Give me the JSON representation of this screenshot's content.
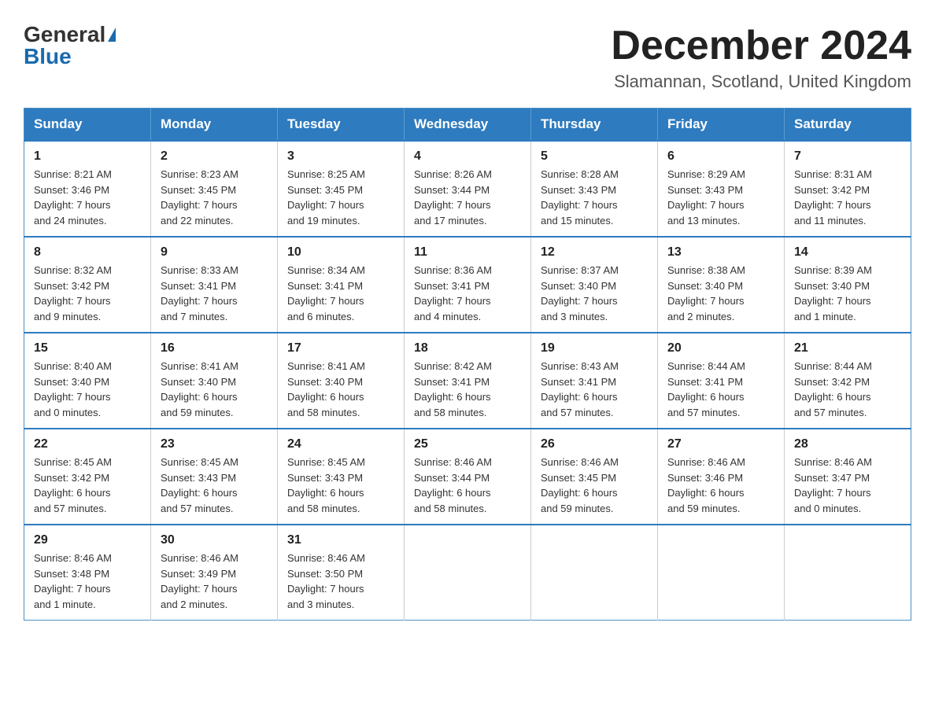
{
  "logo": {
    "general": "General",
    "blue": "Blue"
  },
  "title": "December 2024",
  "location": "Slamannan, Scotland, United Kingdom",
  "weekdays": [
    "Sunday",
    "Monday",
    "Tuesday",
    "Wednesday",
    "Thursday",
    "Friday",
    "Saturday"
  ],
  "weeks": [
    [
      {
        "day": "1",
        "sunrise": "8:21 AM",
        "sunset": "3:46 PM",
        "daylight": "7 hours and 24 minutes."
      },
      {
        "day": "2",
        "sunrise": "8:23 AM",
        "sunset": "3:45 PM",
        "daylight": "7 hours and 22 minutes."
      },
      {
        "day": "3",
        "sunrise": "8:25 AM",
        "sunset": "3:45 PM",
        "daylight": "7 hours and 19 minutes."
      },
      {
        "day": "4",
        "sunrise": "8:26 AM",
        "sunset": "3:44 PM",
        "daylight": "7 hours and 17 minutes."
      },
      {
        "day": "5",
        "sunrise": "8:28 AM",
        "sunset": "3:43 PM",
        "daylight": "7 hours and 15 minutes."
      },
      {
        "day": "6",
        "sunrise": "8:29 AM",
        "sunset": "3:43 PM",
        "daylight": "7 hours and 13 minutes."
      },
      {
        "day": "7",
        "sunrise": "8:31 AM",
        "sunset": "3:42 PM",
        "daylight": "7 hours and 11 minutes."
      }
    ],
    [
      {
        "day": "8",
        "sunrise": "8:32 AM",
        "sunset": "3:42 PM",
        "daylight": "7 hours and 9 minutes."
      },
      {
        "day": "9",
        "sunrise": "8:33 AM",
        "sunset": "3:41 PM",
        "daylight": "7 hours and 7 minutes."
      },
      {
        "day": "10",
        "sunrise": "8:34 AM",
        "sunset": "3:41 PM",
        "daylight": "7 hours and 6 minutes."
      },
      {
        "day": "11",
        "sunrise": "8:36 AM",
        "sunset": "3:41 PM",
        "daylight": "7 hours and 4 minutes."
      },
      {
        "day": "12",
        "sunrise": "8:37 AM",
        "sunset": "3:40 PM",
        "daylight": "7 hours and 3 minutes."
      },
      {
        "day": "13",
        "sunrise": "8:38 AM",
        "sunset": "3:40 PM",
        "daylight": "7 hours and 2 minutes."
      },
      {
        "day": "14",
        "sunrise": "8:39 AM",
        "sunset": "3:40 PM",
        "daylight": "7 hours and 1 minute."
      }
    ],
    [
      {
        "day": "15",
        "sunrise": "8:40 AM",
        "sunset": "3:40 PM",
        "daylight": "7 hours and 0 minutes."
      },
      {
        "day": "16",
        "sunrise": "8:41 AM",
        "sunset": "3:40 PM",
        "daylight": "6 hours and 59 minutes."
      },
      {
        "day": "17",
        "sunrise": "8:41 AM",
        "sunset": "3:40 PM",
        "daylight": "6 hours and 58 minutes."
      },
      {
        "day": "18",
        "sunrise": "8:42 AM",
        "sunset": "3:41 PM",
        "daylight": "6 hours and 58 minutes."
      },
      {
        "day": "19",
        "sunrise": "8:43 AM",
        "sunset": "3:41 PM",
        "daylight": "6 hours and 57 minutes."
      },
      {
        "day": "20",
        "sunrise": "8:44 AM",
        "sunset": "3:41 PM",
        "daylight": "6 hours and 57 minutes."
      },
      {
        "day": "21",
        "sunrise": "8:44 AM",
        "sunset": "3:42 PM",
        "daylight": "6 hours and 57 minutes."
      }
    ],
    [
      {
        "day": "22",
        "sunrise": "8:45 AM",
        "sunset": "3:42 PM",
        "daylight": "6 hours and 57 minutes."
      },
      {
        "day": "23",
        "sunrise": "8:45 AM",
        "sunset": "3:43 PM",
        "daylight": "6 hours and 57 minutes."
      },
      {
        "day": "24",
        "sunrise": "8:45 AM",
        "sunset": "3:43 PM",
        "daylight": "6 hours and 58 minutes."
      },
      {
        "day": "25",
        "sunrise": "8:46 AM",
        "sunset": "3:44 PM",
        "daylight": "6 hours and 58 minutes."
      },
      {
        "day": "26",
        "sunrise": "8:46 AM",
        "sunset": "3:45 PM",
        "daylight": "6 hours and 59 minutes."
      },
      {
        "day": "27",
        "sunrise": "8:46 AM",
        "sunset": "3:46 PM",
        "daylight": "6 hours and 59 minutes."
      },
      {
        "day": "28",
        "sunrise": "8:46 AM",
        "sunset": "3:47 PM",
        "daylight": "7 hours and 0 minutes."
      }
    ],
    [
      {
        "day": "29",
        "sunrise": "8:46 AM",
        "sunset": "3:48 PM",
        "daylight": "7 hours and 1 minute."
      },
      {
        "day": "30",
        "sunrise": "8:46 AM",
        "sunset": "3:49 PM",
        "daylight": "7 hours and 2 minutes."
      },
      {
        "day": "31",
        "sunrise": "8:46 AM",
        "sunset": "3:50 PM",
        "daylight": "7 hours and 3 minutes."
      },
      null,
      null,
      null,
      null
    ]
  ],
  "labels": {
    "sunrise": "Sunrise:",
    "sunset": "Sunset:",
    "daylight": "Daylight:"
  }
}
